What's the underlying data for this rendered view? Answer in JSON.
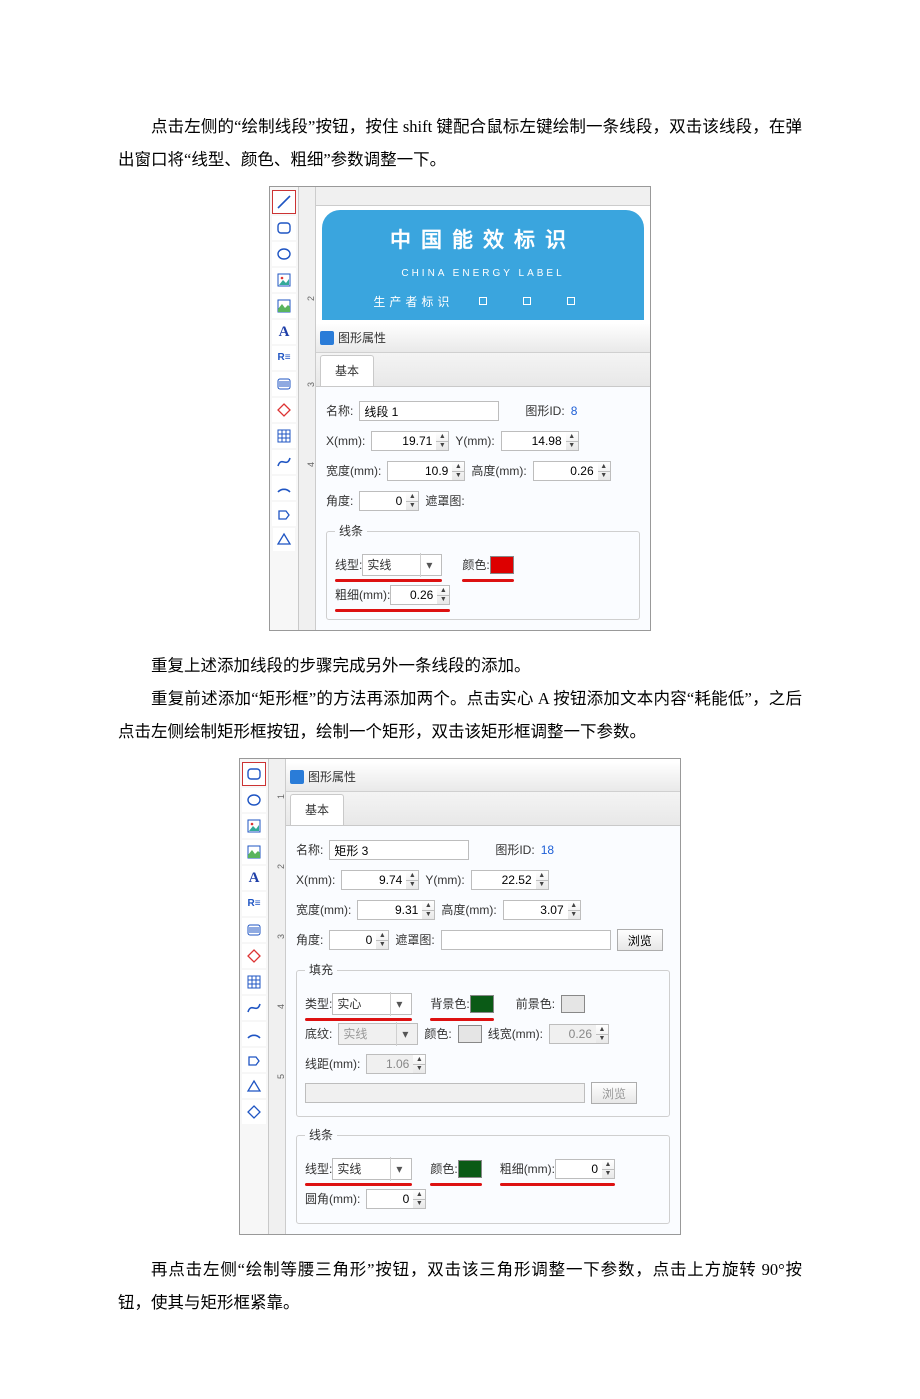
{
  "paragraphs": {
    "p1": "点击左侧的“绘制线段”按钮，按住 shift 键配合鼠标左键绘制一条线段，双击该线段，在弹出窗口将“线型、颜色、粗细”参数调整一下。",
    "p2": "重复上述添加线段的步骤完成另外一条线段的添加。",
    "p3": "重复前述添加“矩形框”的方法再添加两个。点击实心 A 按钮添加文本内容“耗能低”，之后点击左侧绘制矩形框按钮，绘制一个矩形，双击该矩形框调整一下参数。",
    "p4": "再点击左侧“绘制等腰三角形”按钮，双击该三角形调整一下参数，点击上方旋转 90°按钮，使其与矩形框紧靠。"
  },
  "labelCard": {
    "cn": "中国能效标识",
    "en": "CHINA  ENERGY  LABEL",
    "producer": "生产者标识"
  },
  "panel": {
    "title": "图形属性",
    "tabBasic": "基本",
    "labels": {
      "name": "名称:",
      "graphId": "图形ID:",
      "x": "X(mm):",
      "y": "Y(mm):",
      "width": "宽度(mm):",
      "height": "高度(mm):",
      "angle": "角度:",
      "mask": "遮罩图:",
      "browse": "浏览",
      "lineGroup": "线条",
      "lineType": "线型:",
      "color": "颜色:",
      "thickness": "粗细(mm):",
      "fillGroup": "填充",
      "fillType": "类型:",
      "bgcolor": "背景色:",
      "fgcolor": "前景色:",
      "pattern": "底纹:",
      "lineWidth": "线宽(mm):",
      "lineGap": "线距(mm):",
      "corner": "圆角(mm):"
    }
  },
  "shot1": {
    "name": "线段 1",
    "graphId": "8",
    "x": "19.71",
    "y": "14.98",
    "width": "10.9",
    "height": "0.26",
    "angle": "0",
    "lineType": "实线",
    "thickness": "0.26"
  },
  "shot2": {
    "name": "矩形 3",
    "graphId": "18",
    "x": "9.74",
    "y": "22.52",
    "width": "9.31",
    "height": "3.07",
    "angle": "0",
    "fillType": "实心",
    "pattern": "实线",
    "lineWidth": "0.26",
    "lineGap": "1.06",
    "lineType": "实线",
    "thickness": "0",
    "corner": "0"
  }
}
